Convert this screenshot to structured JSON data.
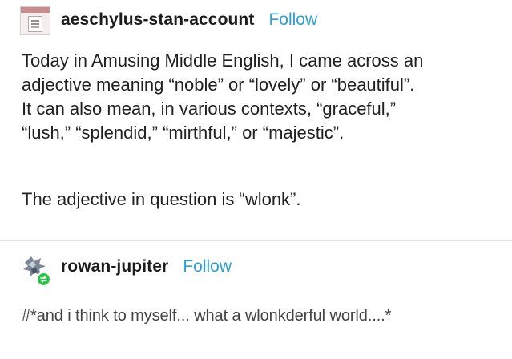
{
  "post1": {
    "username": "aeschylus-stan-account",
    "follow_label": "Follow",
    "avatar_icon": "blog-avatar-icon",
    "paragraphs": [
      {
        "lines": [
          "Today in Amusing Middle English, I came across an",
          "adjective meaning “noble” or “lovely” or “beautiful”.",
          "It can also mean, in various contexts, “graceful,”",
          "“lush,” “splendid,” “mirthful,” or “majestic”."
        ]
      },
      {
        "lines": [
          "The adjective in question is “wlonk”."
        ]
      }
    ]
  },
  "post2": {
    "username": "rowan-jupiter",
    "follow_label": "Follow",
    "avatar_icon": "blog-avatar-icon",
    "badge_icon": "reblog-icon",
    "tags": "#*and i think to myself... what a wlonkderful world....*"
  },
  "colors": {
    "follow": "#2b9fd6",
    "reblog_badge": "#2dc24a",
    "text": "#202020"
  }
}
